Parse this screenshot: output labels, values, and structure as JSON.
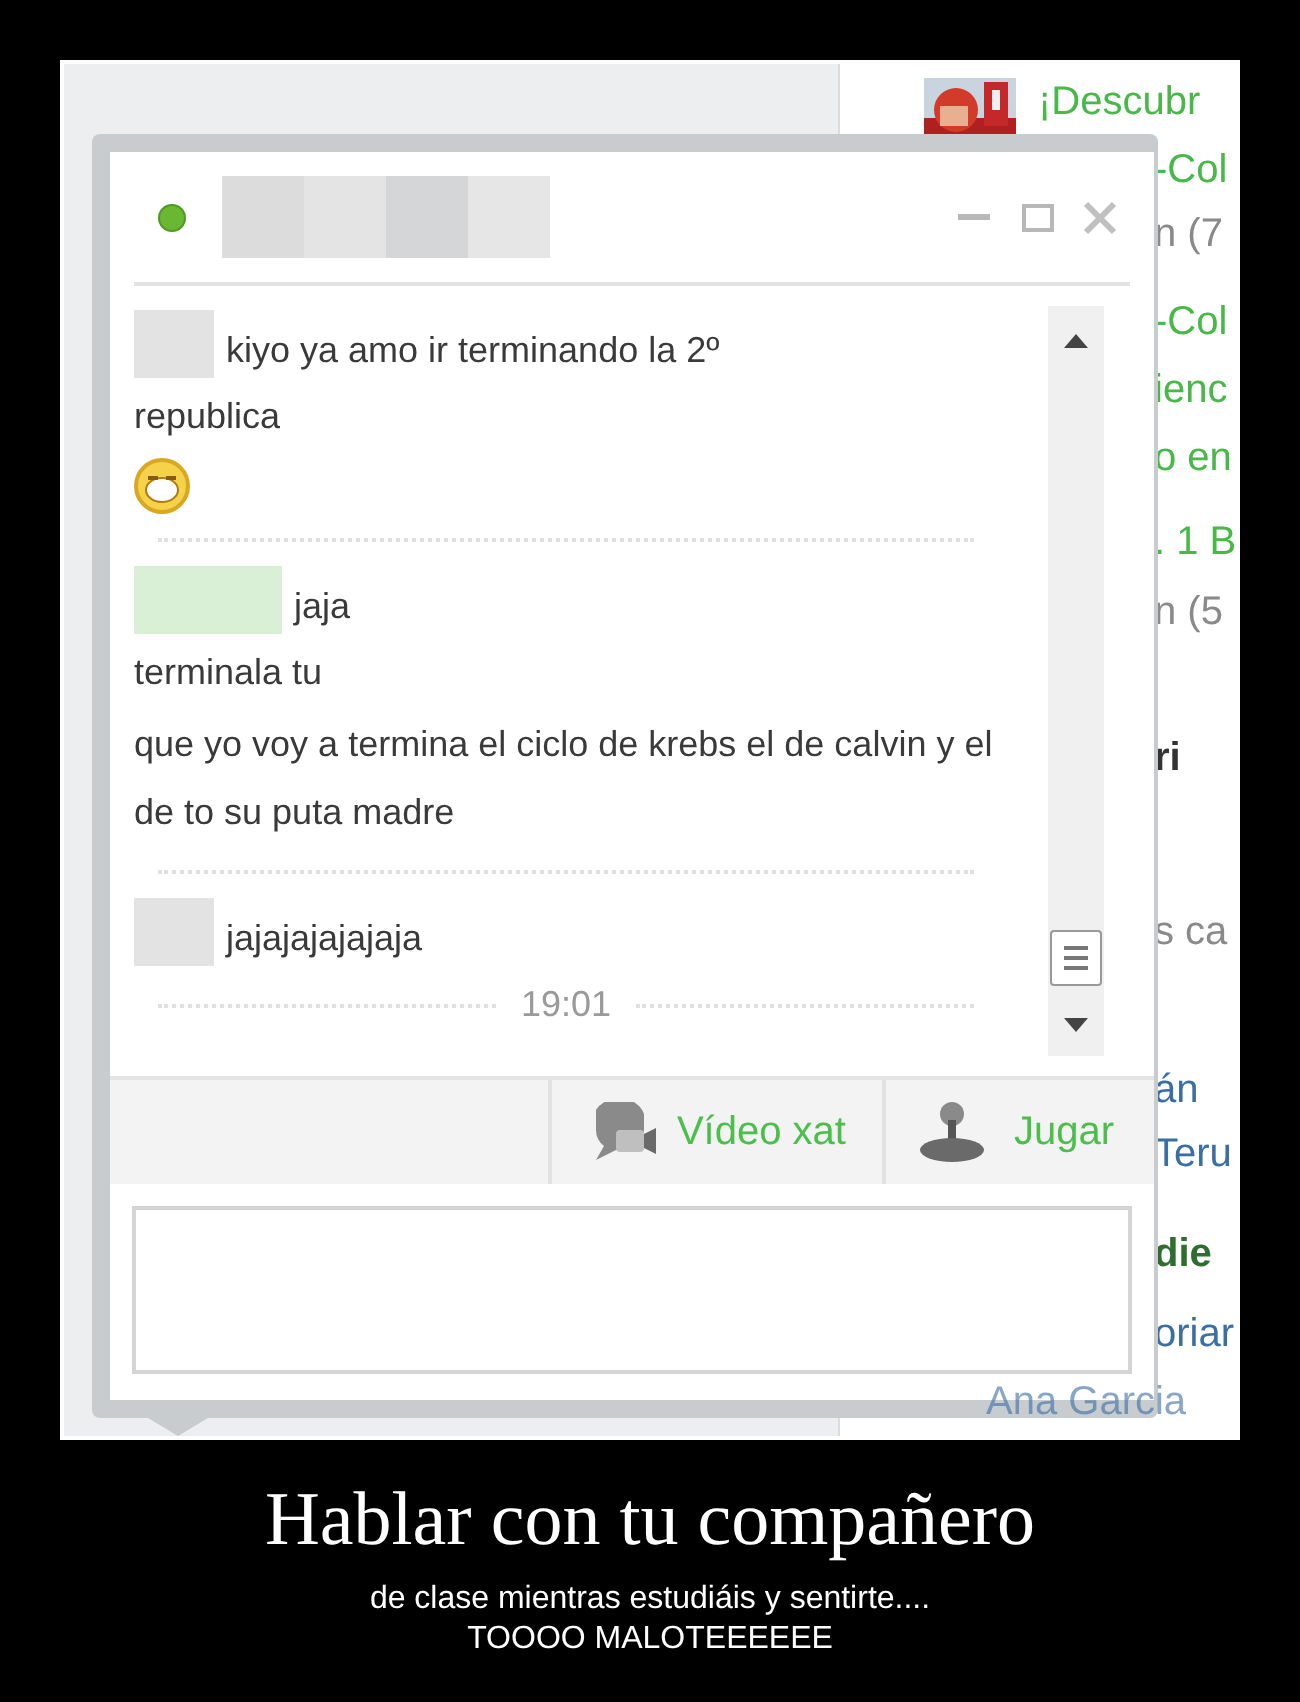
{
  "sidebar": {
    "items": [
      {
        "kind": "link",
        "text": "¡Descubr"
      },
      {
        "kind": "link",
        "text": "-Col"
      },
      {
        "kind": "count",
        "text": "n (7"
      },
      {
        "kind": "link",
        "text": "-Col"
      },
      {
        "kind": "link",
        "text": "ienc"
      },
      {
        "kind": "link",
        "text": "o en"
      },
      {
        "kind": "link",
        "text": ". 1 B"
      },
      {
        "kind": "count",
        "text": "n (5"
      },
      {
        "kind": "heading",
        "text": "ri"
      },
      {
        "kind": "count",
        "text": "s ca"
      },
      {
        "kind": "name",
        "text": "án"
      },
      {
        "kind": "name",
        "text": "Teru"
      },
      {
        "kind": "heading2",
        "text": "die"
      },
      {
        "kind": "name",
        "text": "oriar"
      },
      {
        "kind": "name",
        "text": "Ana Garcia"
      }
    ]
  },
  "chat": {
    "online": true,
    "messages": [
      {
        "color": "#e3e3e3",
        "first": "kiyo ya amo ir terminando la 2º",
        "more": [
          "republica"
        ],
        "emoji": true
      },
      {
        "color": "#d9f0d6",
        "first": "jaja",
        "more": [
          "terminala tu",
          "que yo voy a termina el ciclo de krebs el de calvin y el de to su puta madre"
        ],
        "emoji": false
      },
      {
        "color": "#e3e3e3",
        "first": "jajajajajajaja",
        "emoji": false
      }
    ],
    "timestamp": "19:01",
    "actions": [
      {
        "kind": "video",
        "label": "Vídeo xat"
      },
      {
        "kind": "game",
        "label": "Jugar"
      }
    ]
  },
  "poster": {
    "title": "Hablar con tu compañero",
    "lines": [
      "de clase mientras estudiáis y sentirte....",
      "TOOOO MALOTEEEEEE"
    ]
  }
}
